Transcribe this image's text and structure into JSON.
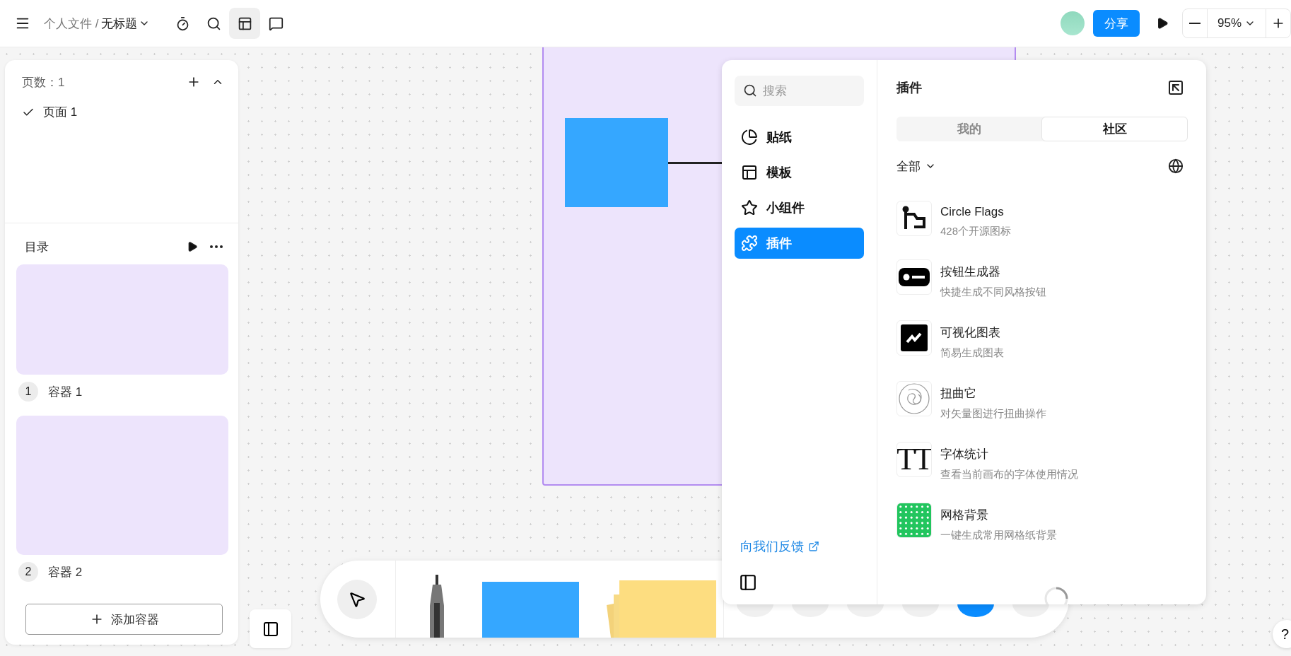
{
  "top_bar": {
    "breadcrumb_parent": "个人文件 /",
    "breadcrumb_current": "无标题",
    "tools": [
      {
        "selected": false
      },
      {
        "selected": false
      },
      {
        "selected": true
      },
      {
        "selected": false
      }
    ],
    "share_button": "分享",
    "zoom": "95%"
  },
  "pages_panel": {
    "count_label": "页数：1",
    "pages": [
      {
        "label": "页面 1",
        "selected": true
      }
    ]
  },
  "outline_panel": {
    "title": "目录",
    "containers": [
      {
        "index": "1",
        "name": "容器 1"
      },
      {
        "index": "2",
        "name": "容器 2"
      }
    ],
    "add_button": "添加容器"
  },
  "plugin_panel": {
    "search": {
      "placeholder": "搜索"
    },
    "nav": [
      {
        "label": "贴纸",
        "selected": false
      },
      {
        "label": "模板",
        "selected": false
      },
      {
        "label": "小组件",
        "selected": false
      },
      {
        "label": "插件",
        "selected": true
      }
    ],
    "feedback_link": "向我们反馈",
    "title": "插件",
    "tabs": [
      {
        "label": "我的",
        "selected": false
      },
      {
        "label": "社区",
        "selected": true
      }
    ],
    "filter": "全部",
    "plugins": [
      {
        "name": "Circle Flags",
        "description": "428个开源图标"
      },
      {
        "name": "按钮生成器",
        "description": "快捷生成不同风格按钮"
      },
      {
        "name": "可视化图表",
        "description": "简易生成图表"
      },
      {
        "name": "扭曲它",
        "description": "对矢量图进行扭曲操作"
      },
      {
        "name": "字体统计",
        "description": "查看当前画布的字体使用情况",
        "icon_text": "TT"
      },
      {
        "name": "网格背景",
        "description": "一键生成常用网格纸背景"
      }
    ]
  },
  "help_button": "?"
}
